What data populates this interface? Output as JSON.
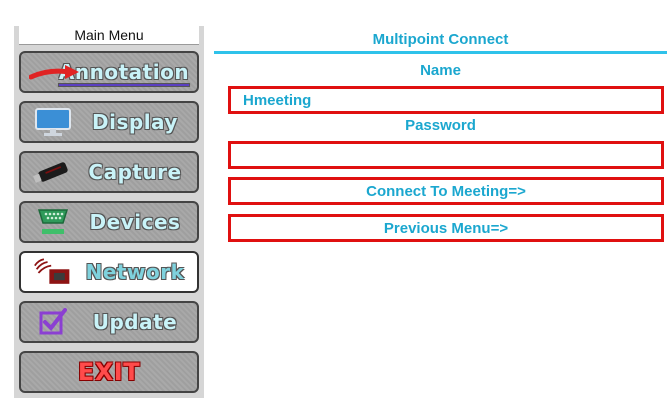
{
  "sidebar": {
    "header": "Main Menu",
    "items": [
      {
        "label": "Annotation",
        "icon": "arrow-pen-icon"
      },
      {
        "label": "Display",
        "icon": "monitor-icon"
      },
      {
        "label": "Capture",
        "icon": "usb-stick-icon"
      },
      {
        "label": "Devices",
        "icon": "serial-port-icon"
      },
      {
        "label": "Network",
        "icon": "wireless-router-icon",
        "active": true
      },
      {
        "label": "Update",
        "icon": "checkbox-icon"
      },
      {
        "label": "EXIT",
        "icon": ""
      }
    ]
  },
  "main": {
    "title": "Multipoint Connect",
    "name_label": "Name",
    "name_value": "Hmeeting",
    "password_label": "Password",
    "password_value": "",
    "connect_button": "Connect To Meeting=>",
    "previous_button": "Previous Menu=>"
  },
  "colors": {
    "accent": "#1ba7cf",
    "border_red": "#e01010",
    "active_item_bg": "#ffffff",
    "exit_red": "#ff4b4b"
  }
}
